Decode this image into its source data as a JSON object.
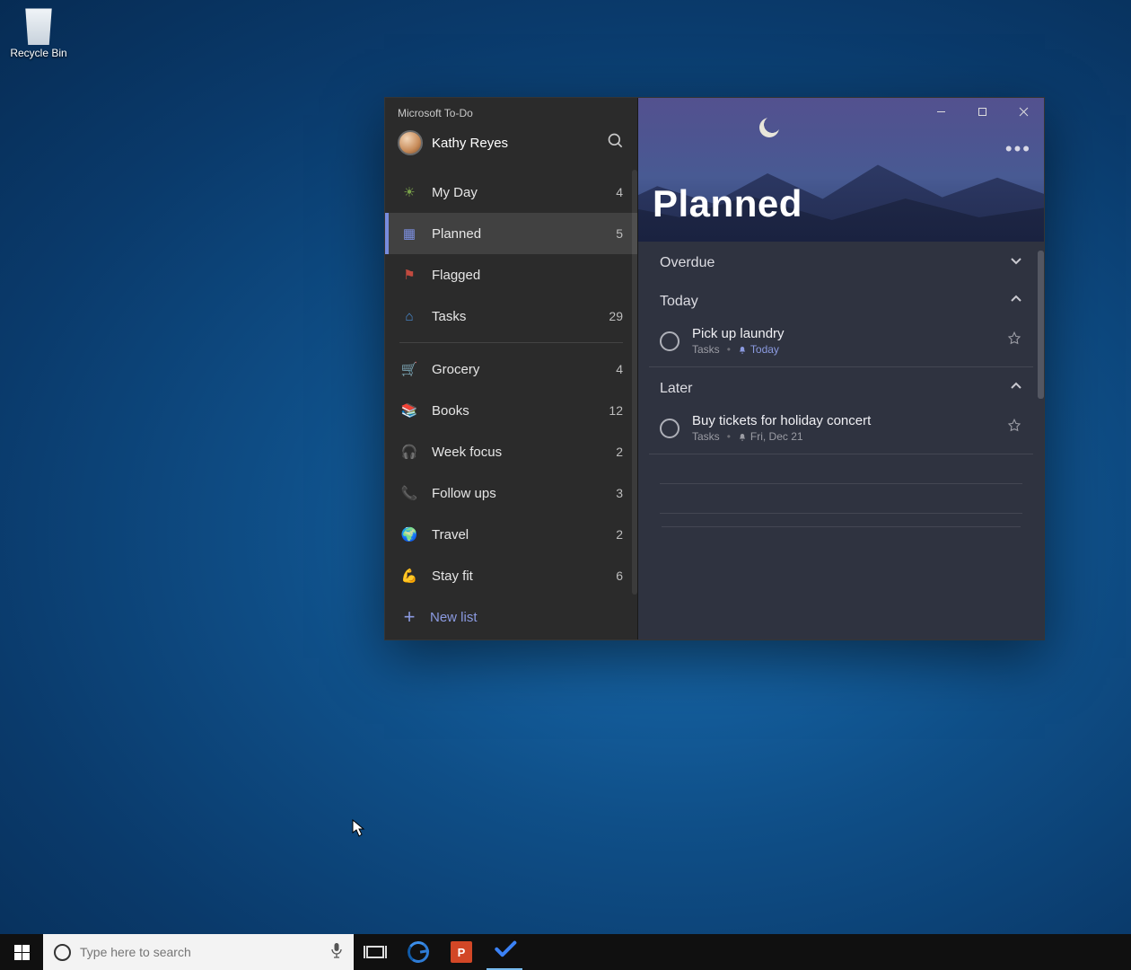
{
  "desktop": {
    "recycle_bin": "Recycle Bin"
  },
  "taskbar": {
    "search_placeholder": "Type here to search",
    "ppt_letter": "P"
  },
  "app": {
    "name": "Microsoft To-Do",
    "user": "Kathy Reyes",
    "new_list": "New list",
    "smart_lists": [
      {
        "icon": "☀",
        "icon_name": "sun-icon",
        "color": "#7aa24a",
        "label": "My Day",
        "count": "4",
        "selected": false
      },
      {
        "icon": "▦",
        "icon_name": "calendar-icon",
        "color": "#7c8fe0",
        "label": "Planned",
        "count": "5",
        "selected": true
      },
      {
        "icon": "⚑",
        "icon_name": "flag-icon",
        "color": "#c24a3f",
        "label": "Flagged",
        "count": "",
        "selected": false
      },
      {
        "icon": "⌂",
        "icon_name": "home-icon",
        "color": "#4a90d9",
        "label": "Tasks",
        "count": "29",
        "selected": false
      }
    ],
    "user_lists": [
      {
        "icon": "🛒",
        "icon_name": "cart-icon",
        "label": "Grocery",
        "count": "4"
      },
      {
        "icon": "📚",
        "icon_name": "books-icon",
        "label": "Books",
        "count": "12"
      },
      {
        "icon": "🎧",
        "icon_name": "headphones-icon",
        "label": "Week focus",
        "count": "2"
      },
      {
        "icon": "📞",
        "icon_name": "phone-icon",
        "label": "Follow ups",
        "count": "3"
      },
      {
        "icon": "🌍",
        "icon_name": "globe-icon",
        "label": "Travel",
        "count": "2"
      },
      {
        "icon": "💪",
        "icon_name": "muscle-icon",
        "label": "Stay fit",
        "count": "6"
      }
    ]
  },
  "main": {
    "title": "Planned",
    "sections": {
      "overdue": {
        "title": "Overdue",
        "expanded": false
      },
      "today": {
        "title": "Today",
        "expanded": true,
        "tasks": [
          {
            "title": "Pick up laundry",
            "list": "Tasks",
            "due": "Today",
            "due_accent": true
          }
        ]
      },
      "later": {
        "title": "Later",
        "expanded": true,
        "tasks": [
          {
            "title": "Buy tickets for holiday concert",
            "list": "Tasks",
            "due": "Fri, Dec 21",
            "due_accent": false
          }
        ]
      }
    }
  }
}
